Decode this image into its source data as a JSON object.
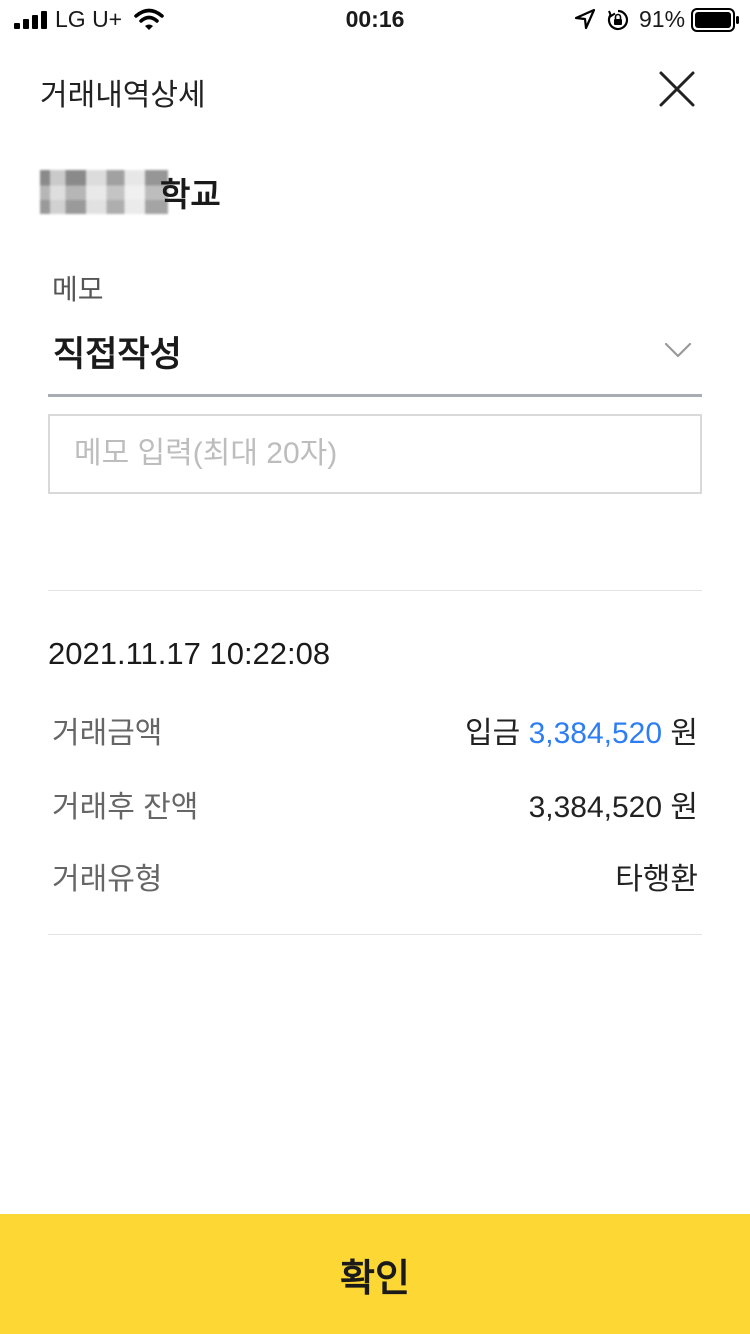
{
  "status_bar": {
    "carrier": "LG U+",
    "time": "00:16",
    "battery": "91%",
    "battery_level": 0.91
  },
  "header": {
    "title": "거래내역상세",
    "close_icon": "close-icon"
  },
  "account": {
    "name_suffix": "학교"
  },
  "memo": {
    "label": "메모",
    "selected": "직접작성",
    "placeholder": "메모 입력(최대 20자)",
    "value": ""
  },
  "transaction": {
    "datetime": "2021.11.17 10:22:08",
    "rows": [
      {
        "label": "거래금액",
        "prefix": "입금",
        "amount": "3,384,520",
        "unit": "원"
      },
      {
        "label": "거래후 잔액",
        "amount": "3,384,520",
        "unit": "원"
      },
      {
        "label": "거래유형",
        "value": "타행환"
      }
    ]
  },
  "confirm": {
    "label": "확인"
  },
  "colors": {
    "accent_yellow": "#fdd835",
    "amount_blue": "#2d7df3",
    "divider": "#e3e3e3"
  }
}
